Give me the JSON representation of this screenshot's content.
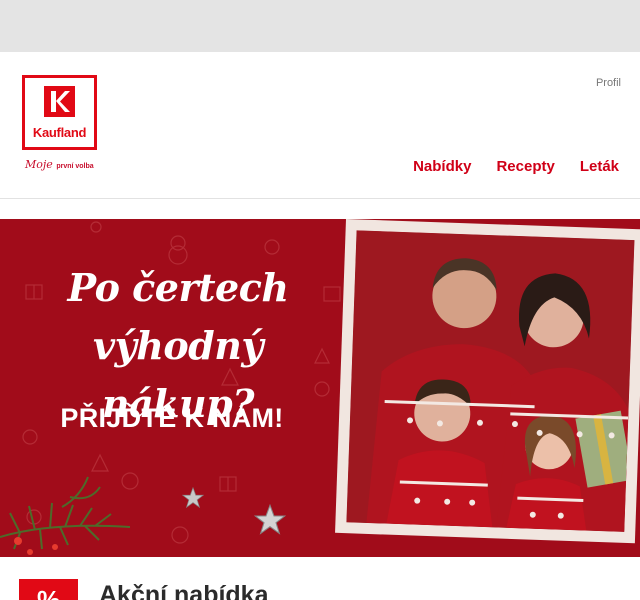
{
  "header": {
    "logo_text": "Kaufland",
    "slogan_main": "Moje",
    "slogan_small": "první volba",
    "profile_label": "Profil",
    "nav": [
      {
        "label": "Nabídky"
      },
      {
        "label": "Recepty"
      },
      {
        "label": "Leták"
      }
    ]
  },
  "banner": {
    "headline_line1": "Po čertech",
    "headline_line2": "výhodný nákup?",
    "subhead": "PŘIJĎTE K NÁM!"
  },
  "section": {
    "badge": "%",
    "title": "Akční nabídka"
  },
  "colors": {
    "brand_red": "#e10915",
    "banner_red": "#a10c1a",
    "top_bar": "#e4e4e4"
  }
}
